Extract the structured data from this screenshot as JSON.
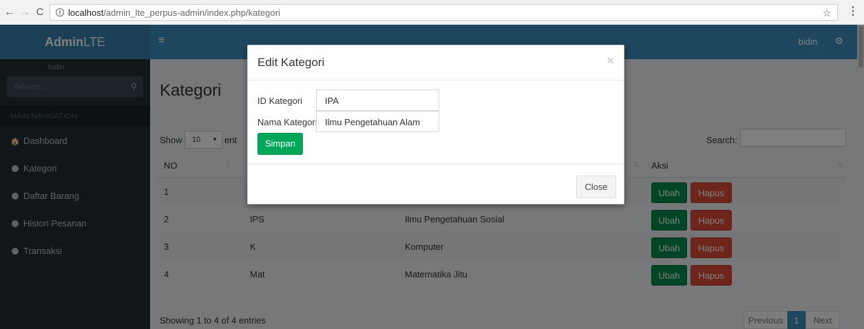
{
  "browser": {
    "url_host": "localhost",
    "url_path": "/admin_lte_perpus-admin/index.php/kategori",
    "back": "←",
    "forward": "→",
    "reload": "C",
    "info": "i",
    "star": "☆",
    "menu": "⋮"
  },
  "header": {
    "logo_bold": "Admin",
    "logo_rest": "LTE",
    "menu_toggle": "≡",
    "user": "bidin",
    "settings": "⚙"
  },
  "sidebar": {
    "user": "bidin",
    "search_placeholder": "Search...",
    "search_glyph": "⚲",
    "section": "MAIN NAVIGATION",
    "dashboard_glyph": "🏠",
    "items": [
      {
        "label": "Dashboard"
      },
      {
        "label": "Kategori"
      },
      {
        "label": "Daftar Barang"
      },
      {
        "label": "Histori Pesanan"
      },
      {
        "label": "Transaksi"
      }
    ]
  },
  "page": {
    "title": "Kategori",
    "show_label": "Show",
    "page_length": "10",
    "caret": "▼",
    "entries_label": "ent",
    "search_label": "Search:",
    "sort_glyph": "⇅",
    "sort_active_glyph": "⇂",
    "table": {
      "headers": {
        "no": "NO",
        "aksi": "Aksi"
      },
      "rows": [
        {
          "no": "1",
          "id": "",
          "nama": ""
        },
        {
          "no": "2",
          "id": "IPS",
          "nama": "Ilmu Pengetahuan Sosial"
        },
        {
          "no": "3",
          "id": "K",
          "nama": "Komputer"
        },
        {
          "no": "4",
          "id": "Mat",
          "nama": "Matematika Jitu"
        }
      ],
      "ubah_label": "Ubah",
      "hapus_label": "Hapus"
    },
    "info": "Showing 1 to 4 of 4 entries",
    "pager": {
      "prev": "Previous",
      "current": "1",
      "next": "Next"
    }
  },
  "modal": {
    "title": "Edit Kategori",
    "close_x": "×",
    "id_label": "ID Kategori",
    "id_value": "IPA",
    "nama_label": "Nama Kategori",
    "nama_value": "Ilmu Pengetahuan Alam",
    "simpan_label": "Simpan",
    "close_label": "Close"
  },
  "colors": {
    "primary": "#3c8dbc",
    "sidebar": "#222d32",
    "success": "#00a65a",
    "danger": "#dd4b39"
  }
}
